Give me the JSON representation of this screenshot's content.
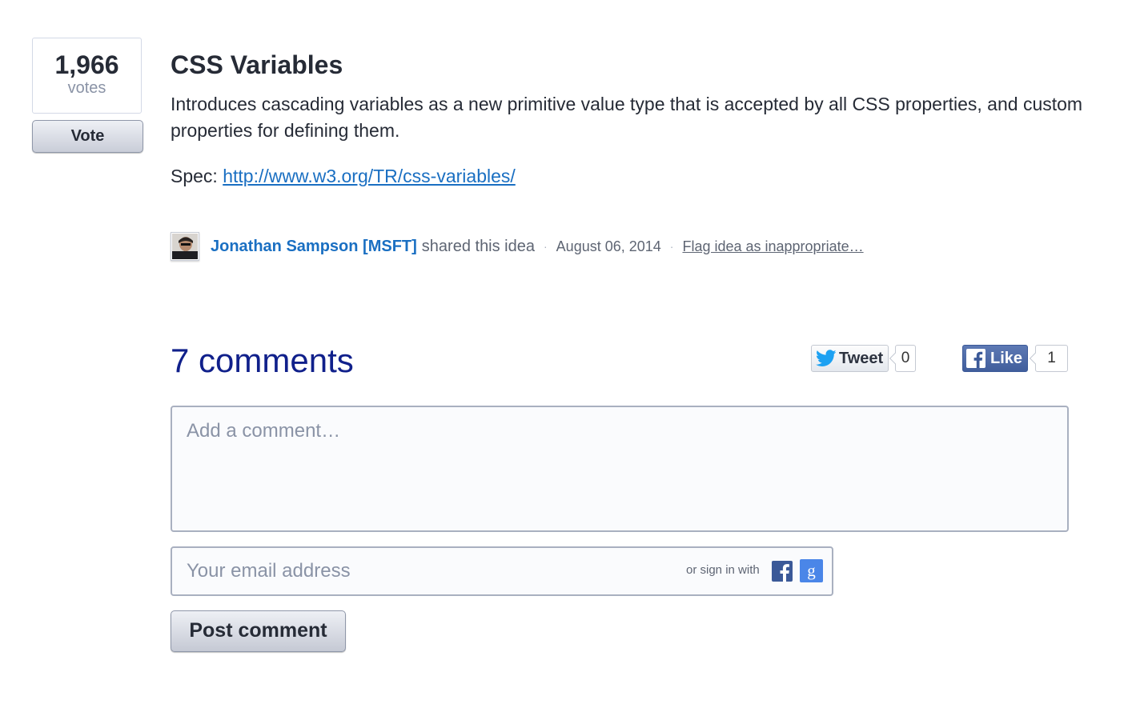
{
  "idea": {
    "vote_count": "1,966",
    "votes_label": "votes",
    "vote_button": "Vote",
    "title": "CSS Variables",
    "description": "Introduces cascading variables as a new primitive value type that is accepted by all CSS properties, and custom properties for defining them.",
    "spec_label": "Spec: ",
    "spec_url": "http://www.w3.org/TR/css-variables/"
  },
  "meta": {
    "avatar_icon": "user-avatar",
    "author": "Jonathan Sampson [MSFT]",
    "action_text": "shared this idea",
    "separator": "·",
    "date": "August 06, 2014",
    "flag_link": "Flag idea as inappropriate…"
  },
  "comments": {
    "title": "7 comments",
    "comment_placeholder": "Add a comment…",
    "email_placeholder": "Your email address",
    "signin_label": "or sign in with",
    "post_button": "Post comment"
  },
  "social": {
    "tweet_label": "Tweet",
    "tweet_count": "0",
    "like_label": "Like",
    "like_count": "1",
    "twitter_color": "#1da1f2",
    "facebook_color": "#3b5998",
    "google_color": "#4a86e8"
  },
  "colors": {
    "link": "#1a6fc2",
    "comments_title": "#10208b",
    "text": "#262b36",
    "muted": "#8a93a6"
  }
}
